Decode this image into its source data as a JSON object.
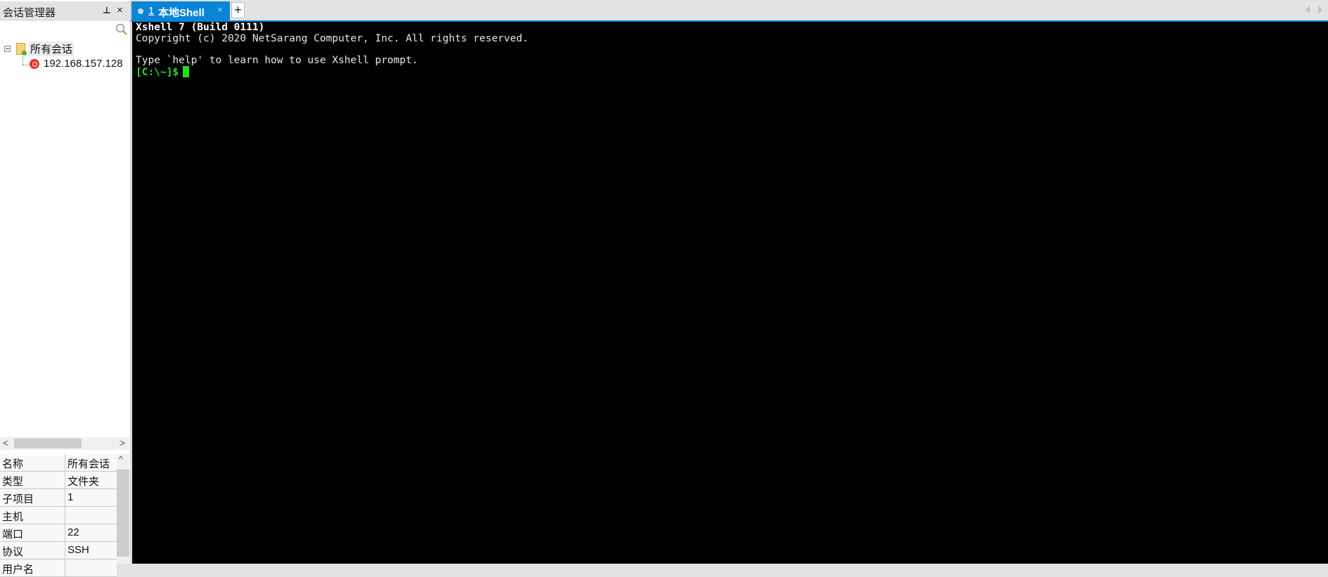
{
  "sidebar": {
    "title": "会话管理器",
    "pin_icon": "pin-icon",
    "close_icon": "close-icon",
    "search": {
      "value": "",
      "placeholder": ""
    },
    "tree": {
      "root_label": "所有会话",
      "children": [
        {
          "label": "192.168.157.128",
          "icon": "session-icon"
        }
      ]
    },
    "properties": [
      {
        "key": "名称",
        "value": "所有会话"
      },
      {
        "key": "类型",
        "value": "文件夹"
      },
      {
        "key": "子项目",
        "value": "1"
      },
      {
        "key": "主机",
        "value": ""
      },
      {
        "key": "端口",
        "value": "22"
      },
      {
        "key": "协议",
        "value": "SSH"
      },
      {
        "key": "用户名",
        "value": ""
      }
    ]
  },
  "tabs": {
    "active": {
      "number": "1",
      "label": "本地Shell",
      "close": "×"
    },
    "add_label": "+"
  },
  "terminal": {
    "lines": [
      "Xshell 7 (Build 0111)",
      "Copyright (c) 2020 NetSarang Computer, Inc. All rights reserved.",
      "",
      "Type `help' to learn how to use Xshell prompt."
    ],
    "prompt": "[C:\\~]$"
  },
  "colors": {
    "accent": "#0a84d6",
    "prompt": "#2bdc2b",
    "terminal_bg": "#000000"
  }
}
